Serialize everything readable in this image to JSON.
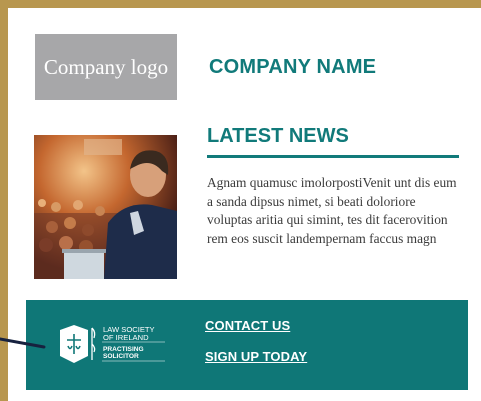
{
  "header": {
    "logo_text": "Company logo",
    "company_name": "COMPANY NAME"
  },
  "news": {
    "title": "LATEST NEWS",
    "body": "Agnam quamusc imolorpostiVenit unt dis eum a sanda dipsus nimet, si beati doloriore voluptas aritia qui simint, tes dit facerovition rem eos suscit landempernam faccus magn"
  },
  "footer": {
    "society_lines": [
      "LAW SOCIETY",
      "OF IRELAND",
      "PRACTISING",
      "SOLICITOR"
    ],
    "contact_label": "CONTACT US",
    "signup_label": "SIGN UP TODAY"
  },
  "colors": {
    "frame": "#b8974f",
    "accent": "#117a7a",
    "footer_bg": "#0f7777",
    "logo_placeholder": "#a7a7a9"
  }
}
